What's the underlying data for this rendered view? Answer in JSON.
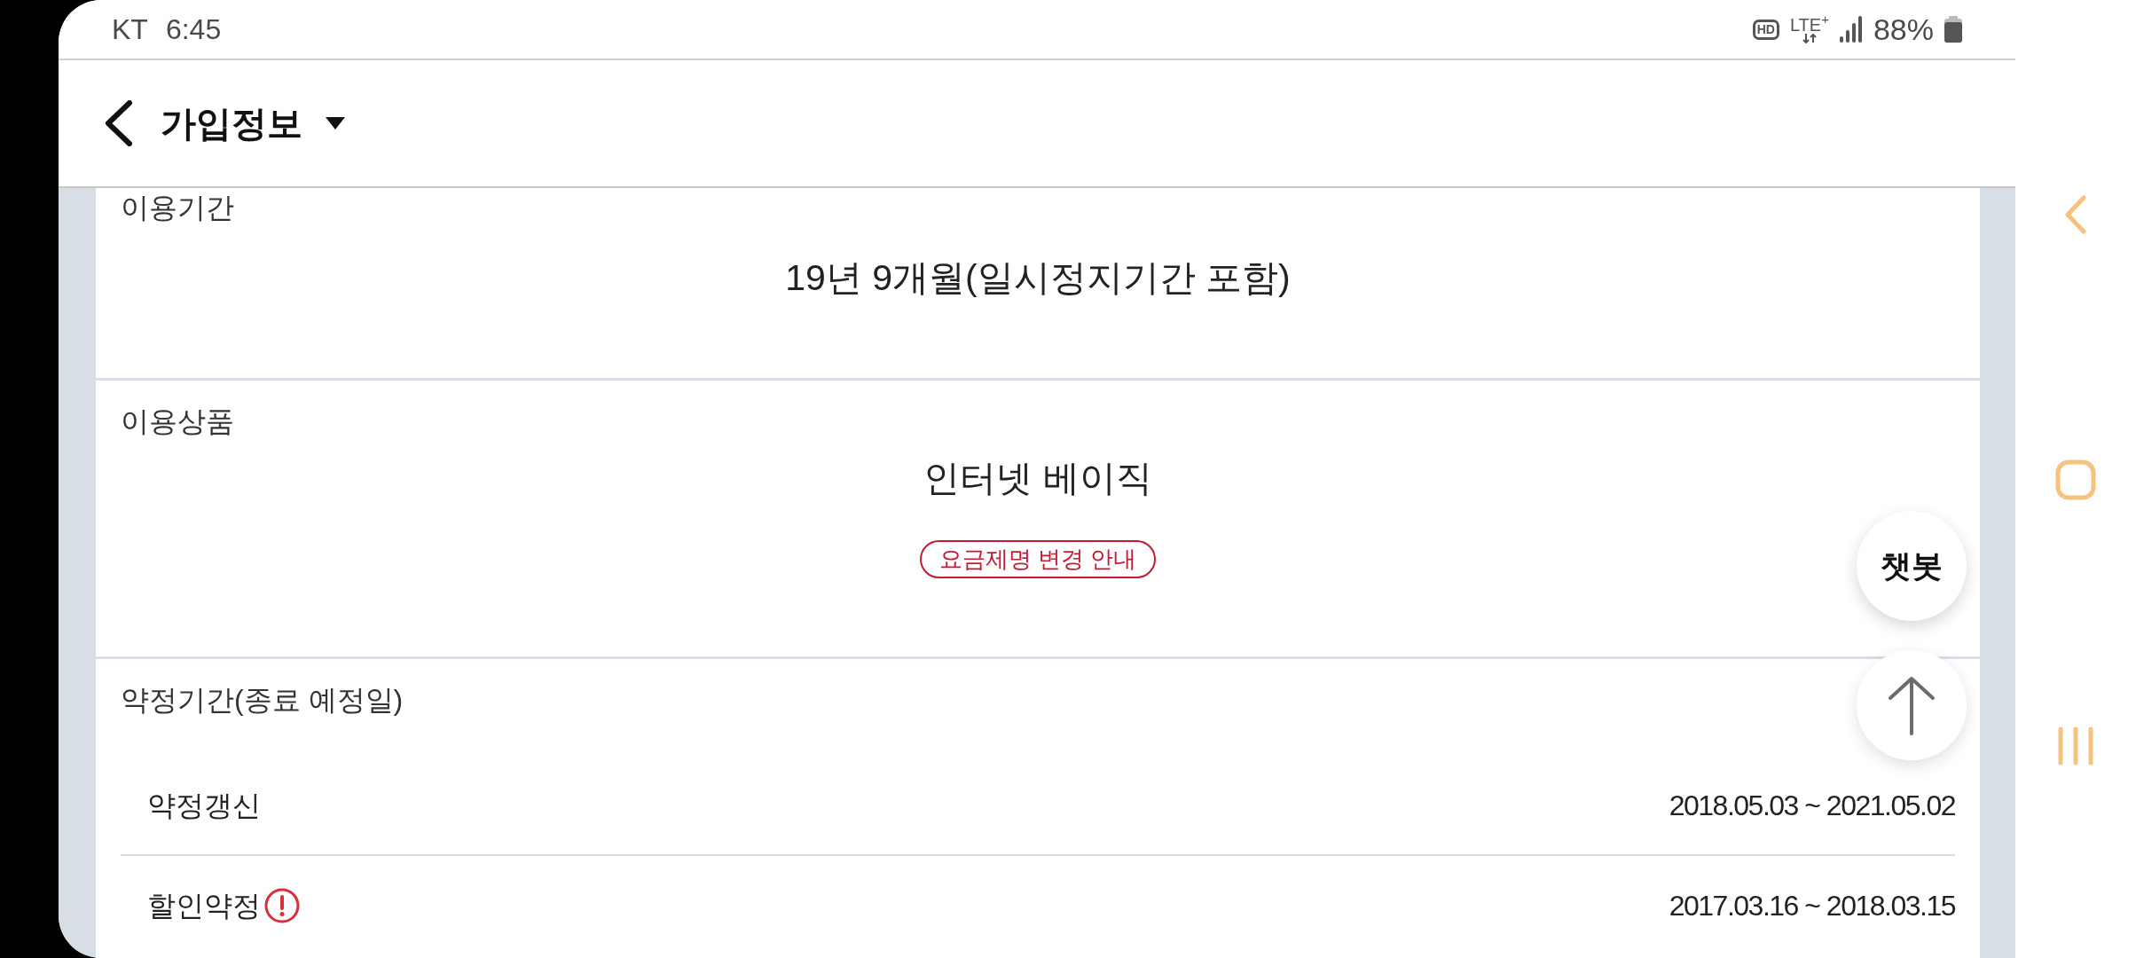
{
  "status_bar": {
    "carrier": "KT",
    "time": "6:45",
    "hd": "HD",
    "network": "LTE$^{+}$",
    "battery": "88%"
  },
  "header": {
    "title": "가입정보"
  },
  "sections": [
    {
      "kind": "text",
      "label": "이용기간",
      "value": "19년 9개월(일시정지기간 포함)"
    },
    {
      "kind": "text",
      "label": "이용상품",
      "value": "인터넷 베이직",
      "badge": "요금제명 변경 안내"
    },
    {
      "kind": "periods",
      "label": "약정기간(종료 예정일)",
      "rows": [
        {
          "label": "약정갱신",
          "value": "2018.05.03 ~ 2021.05.02",
          "alert": false
        },
        {
          "label": "할인약정",
          "value": "2017.03.16 ~ 2018.03.15",
          "alert": true
        }
      ]
    }
  ],
  "floating": {
    "chatbot": "챗봇"
  }
}
